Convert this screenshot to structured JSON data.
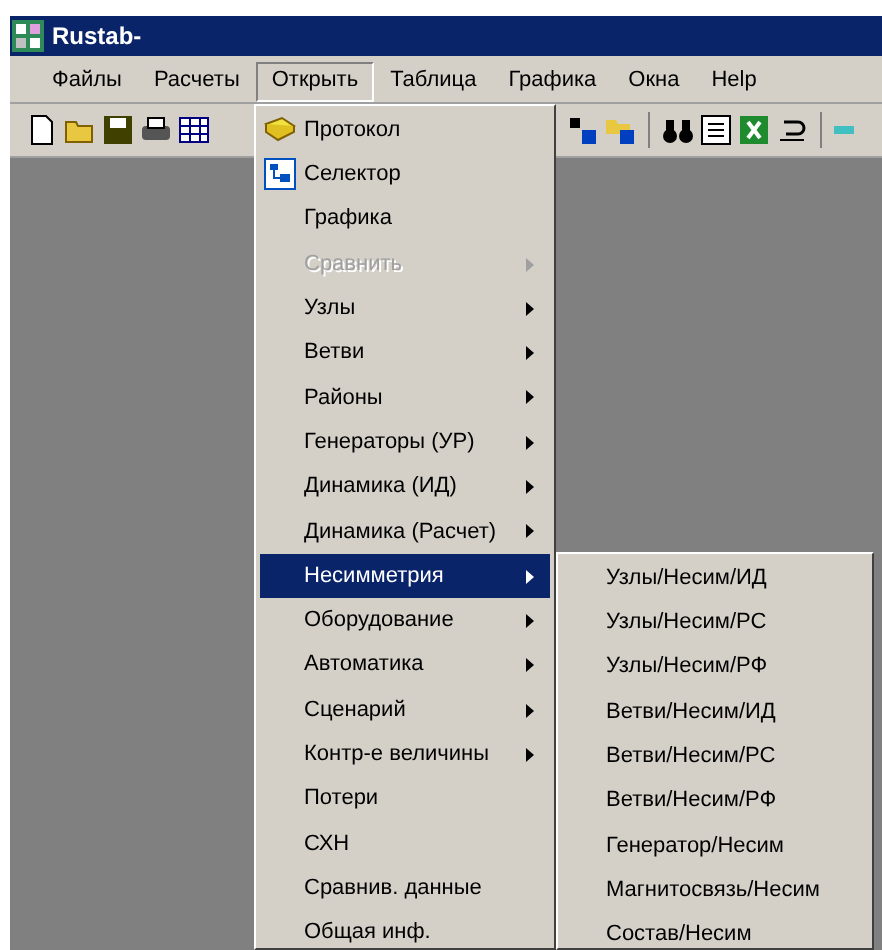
{
  "window": {
    "title": "Rustab-"
  },
  "menu_bar": [
    {
      "label": "Файлы",
      "selected": false
    },
    {
      "label": "Расчеты",
      "selected": false
    },
    {
      "label": "Открыть",
      "selected": true
    },
    {
      "label": "Таблица",
      "selected": false
    },
    {
      "label": "Графика",
      "selected": false
    },
    {
      "label": "Окна",
      "selected": false
    },
    {
      "label": "Help",
      "selected": false
    }
  ],
  "menu": [
    {
      "label": "Протокол",
      "kind": "book",
      "disabled": false,
      "submenu": false,
      "selected": false
    },
    {
      "label": "Селектор",
      "kind": "selector",
      "disabled": false,
      "submenu": false,
      "selected": false
    },
    {
      "label": "Графика",
      "kind": "text",
      "disabled": false,
      "submenu": false,
      "selected": false
    },
    {
      "label": "Сравнить",
      "kind": "text",
      "disabled": true,
      "submenu": true,
      "selected": false
    },
    {
      "label": "Узлы",
      "kind": "text",
      "disabled": false,
      "submenu": true,
      "selected": false
    },
    {
      "label": "Ветви",
      "kind": "text",
      "disabled": false,
      "submenu": true,
      "selected": false
    },
    {
      "label": "Районы",
      "kind": "text",
      "disabled": false,
      "submenu": true,
      "selected": false
    },
    {
      "label": "Генераторы (УР)",
      "kind": "text",
      "disabled": false,
      "submenu": true,
      "selected": false
    },
    {
      "label": "Динамика (ИД)",
      "kind": "text",
      "disabled": false,
      "submenu": true,
      "selected": false
    },
    {
      "label": "Динамика (Расчет)",
      "kind": "text",
      "disabled": false,
      "submenu": true,
      "selected": false
    },
    {
      "label": "Несимметрия",
      "kind": "text",
      "disabled": false,
      "submenu": true,
      "selected": true
    },
    {
      "label": "Оборудование",
      "kind": "text",
      "disabled": false,
      "submenu": true,
      "selected": false
    },
    {
      "label": "Автоматика",
      "kind": "text",
      "disabled": false,
      "submenu": true,
      "selected": false
    },
    {
      "label": "Сценарий",
      "kind": "text",
      "disabled": false,
      "submenu": true,
      "selected": false
    },
    {
      "label": "Контр-е величины",
      "kind": "text",
      "disabled": false,
      "submenu": true,
      "selected": false
    },
    {
      "label": "Потери",
      "kind": "text",
      "disabled": false,
      "submenu": false,
      "selected": false
    },
    {
      "label": "СХН",
      "kind": "text",
      "disabled": false,
      "submenu": false,
      "selected": false
    },
    {
      "label": "Сравнив. данные",
      "kind": "text",
      "disabled": false,
      "submenu": false,
      "selected": false
    },
    {
      "label": "Общая инф.",
      "kind": "text",
      "disabled": false,
      "submenu": false,
      "selected": false
    }
  ],
  "submenu": [
    "Узлы/Несим/ИД",
    "Узлы/Несим/РС",
    "Узлы/Несим/РФ",
    "Ветви/Несим/ИД",
    "Ветви/Несим/РС",
    "Ветви/Несим/РФ",
    "Генератор/Несим",
    "Магнитосвязь/Несим",
    "Состав/Несим"
  ]
}
